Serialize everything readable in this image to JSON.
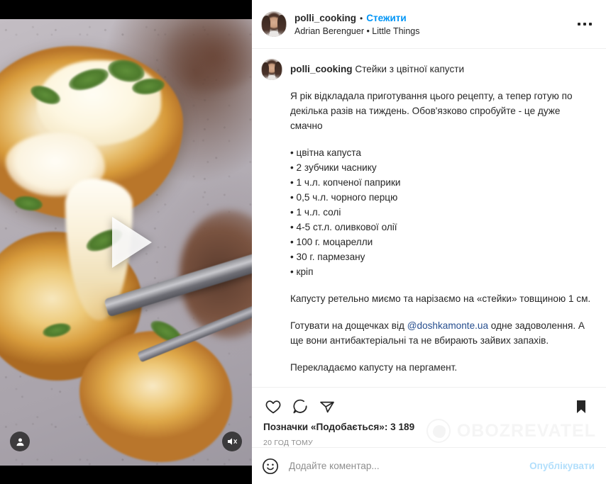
{
  "colors": {
    "instagram_blue": "#0095f6",
    "text_primary": "#262626",
    "text_muted": "#8e8e8e",
    "mention_blue": "#274f8f",
    "post_button_disabled": "#b2dffc",
    "divider": "#efefef"
  },
  "media": {
    "type": "video",
    "play_icon": "play-triangle-icon",
    "tag_icon": "person-tag-icon",
    "mute_icon": "speaker-muted-icon",
    "alt": "Cauliflower steaks baked with melted mozzarella cheese and fresh dill on parchment paper, with a fork"
  },
  "header": {
    "avatar": "user-avatar",
    "username": "polli_cooking",
    "separator": "•",
    "follow_label": "Стежити",
    "audio_line": "Adrian Berenguer • Little Things",
    "more_icon": "more-options-icon"
  },
  "caption": {
    "avatar": "user-avatar",
    "username": "polli_cooking",
    "title": "Стейки з цвітної капусти",
    "intro": "Я рік відкладала приготування цього рецепту, а тепер готую по декілька разів на тиждень. Обов'язково спробуйте - це дуже смачно",
    "ingredients": [
      "• цвітна капуста",
      "• 2 зубчики часнику",
      "• 1 ч.л. копченої паприки",
      "• 0,5 ч.л. чорного перцю",
      "• 1 ч.л. солі",
      "• 4-5 ст.л. оливкової олії",
      "• 100 г. моцарелли",
      "• 30 г. пармезану",
      "• кріп"
    ],
    "step1": "Капусту ретельно миємо та нарізаємо на «стейки» товщиною 1 см.",
    "sponsor_before": "Готувати на дощечках від ",
    "sponsor_mention": "@doshkamonte.ua",
    "sponsor_after": " одне задоволення. А ще вони антибактеріальні та не вбирають зайвих запахів.",
    "step2": "Перекладаємо капусту на пергамент."
  },
  "actions": {
    "like_icon": "heart-icon",
    "comment_icon": "comment-bubble-icon",
    "share_icon": "share-paper-plane-icon",
    "save_icon": "bookmark-filled-icon",
    "likes_text": "Позначки «Подобається»: 3 189",
    "likes_count": "3 189",
    "time_ago": "20 ГОД ТОМУ"
  },
  "composer": {
    "emoji_icon": "emoji-smiley-icon",
    "placeholder": "Додайте коментар...",
    "value": "",
    "post_label": "Опублікувати"
  },
  "watermark": {
    "logo_icon": "globe-icon",
    "text": "OBOZREVATEL"
  }
}
